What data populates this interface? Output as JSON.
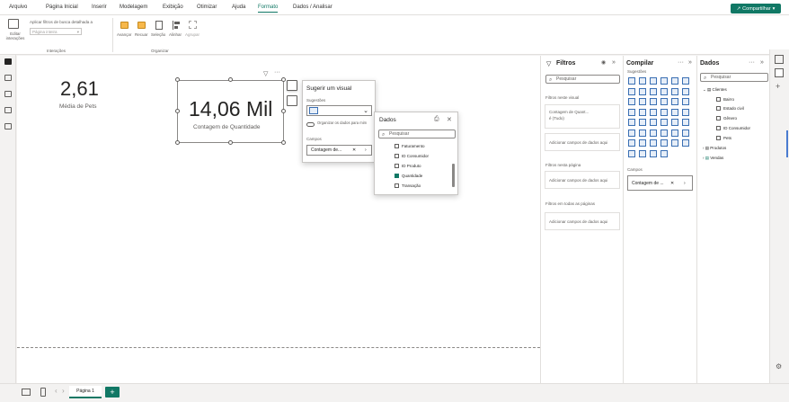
{
  "menu": {
    "tabs": [
      "Arquivo",
      "Página Inicial",
      "Inserir",
      "Modelagem",
      "Exibição",
      "Otimizar",
      "Ajuda",
      "Formato",
      "Dados / Analisar"
    ],
    "active": "Formato",
    "share_label": "Compartilhar"
  },
  "ribbon": {
    "edit_interactions": "Editar interações",
    "drill_filter_label": "Aplicar filtros de busca detalhada a",
    "drill_filter_placeholder": "Página inteira",
    "group_interactions": "Interações",
    "arrange_buttons": [
      "Avançar",
      "Recuar",
      "Seleção",
      "Alinhar",
      "Agrupar"
    ],
    "group_arrange": "Organizar"
  },
  "cards": {
    "pets": {
      "value": "2,61",
      "label": "Média de Pets"
    },
    "quantity": {
      "value": "14,06 Mil",
      "label": "Contagem de Quantidade"
    }
  },
  "suggest": {
    "title": "Sugerir um visual",
    "suggestions_label": "Sugestões",
    "organize_label": "Organizar os dados para mim",
    "fields_label": "Campos",
    "field_value": "Contagem de..."
  },
  "data_popup": {
    "title": "Dados",
    "search_placeholder": "Pesquisar",
    "items": [
      {
        "label": "Faturamento",
        "checked": false
      },
      {
        "label": "ID Consumidor",
        "checked": false
      },
      {
        "label": "ID Produto",
        "checked": false
      },
      {
        "label": "Quantidade",
        "checked": true
      },
      {
        "label": "Transação",
        "checked": false
      }
    ]
  },
  "filters": {
    "title": "Filtros",
    "search_placeholder": "Pesquisar",
    "on_visual": "Filtros neste visual",
    "visual_field": "Contagem de Quant...",
    "visual_field_sub": "é (Tudo)",
    "add_field": "Adicionar campos de dados aqui",
    "on_page": "Filtros nesta página",
    "on_all_pages": "Filtros em todas as páginas"
  },
  "build": {
    "title": "Compilar",
    "suggestions_label": "Sugestões",
    "fields_label": "Campos",
    "field_value": "Contagem de ..."
  },
  "data_pane": {
    "title": "Dados",
    "search_placeholder": "Pesquisar",
    "tables": [
      {
        "name": "Clientes",
        "expanded": true,
        "fields": [
          "Bairro",
          "Estado civil",
          "Gênero",
          "ID Consumidor",
          "Pets"
        ]
      },
      {
        "name": "Produtos",
        "expanded": false,
        "fields": []
      },
      {
        "name": "Vendas",
        "expanded": false,
        "fields": []
      }
    ]
  },
  "pages": {
    "current": "Página 1",
    "add": "+"
  },
  "colors": {
    "accent": "#117865"
  }
}
